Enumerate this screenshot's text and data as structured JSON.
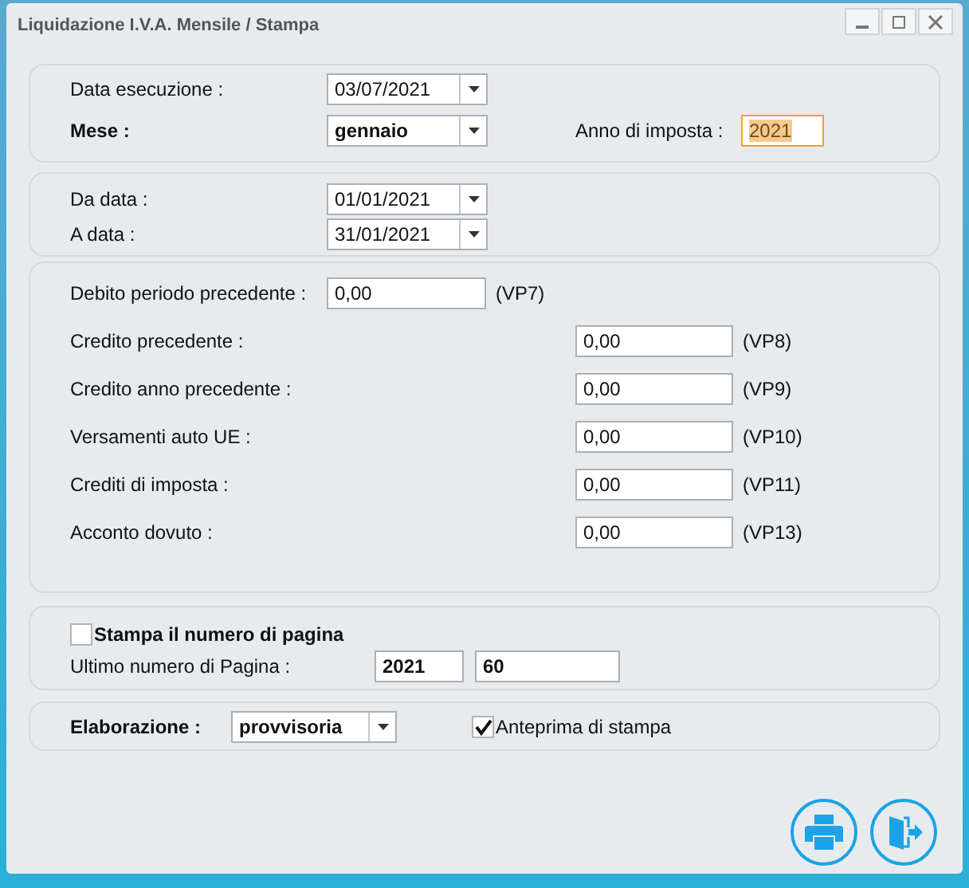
{
  "window": {
    "title": "Liquidazione I.V.A. Mensile / Stampa"
  },
  "header": {
    "execution_date": {
      "label": "Data esecuzione :",
      "value": "03/07/2021"
    },
    "month": {
      "label": "Mese :",
      "value": "gennaio"
    },
    "tax_year": {
      "label": "Anno di imposta :",
      "value": "2021",
      "focused": true
    }
  },
  "period": [
    {
      "label": "Da data :",
      "value": "01/01/2021"
    },
    {
      "label": "A data :",
      "value": "31/01/2021"
    }
  ],
  "amounts": [
    {
      "kind": "inline",
      "label": "Debito periodo precedente :",
      "value": "0,00",
      "code": "(VP7)"
    },
    {
      "kind": "column",
      "label": "Credito precedente :",
      "value": "0,00",
      "code": "(VP8)"
    },
    {
      "kind": "column",
      "label": "Credito anno precedente :",
      "value": "0,00",
      "code": "(VP9)"
    },
    {
      "kind": "column",
      "label": "Versamenti auto UE :",
      "value": "0,00",
      "code": "(VP10)"
    },
    {
      "kind": "column",
      "label": "Crediti di imposta :",
      "value": "0,00",
      "code": "(VP11)"
    },
    {
      "kind": "column",
      "label": "Acconto dovuto :",
      "value": "0,00",
      "code": "(VP13)"
    }
  ],
  "page_numbering": {
    "label": "Stampa il numero di pagina",
    "checked": false,
    "last_label": "Ultimo numero di Pagina :",
    "year": "2021",
    "number": "60"
  },
  "processing": {
    "label": "Elaborazione :",
    "value": "provvisoria",
    "preview": {
      "label": "Anteprima di stampa",
      "checked": true
    }
  }
}
